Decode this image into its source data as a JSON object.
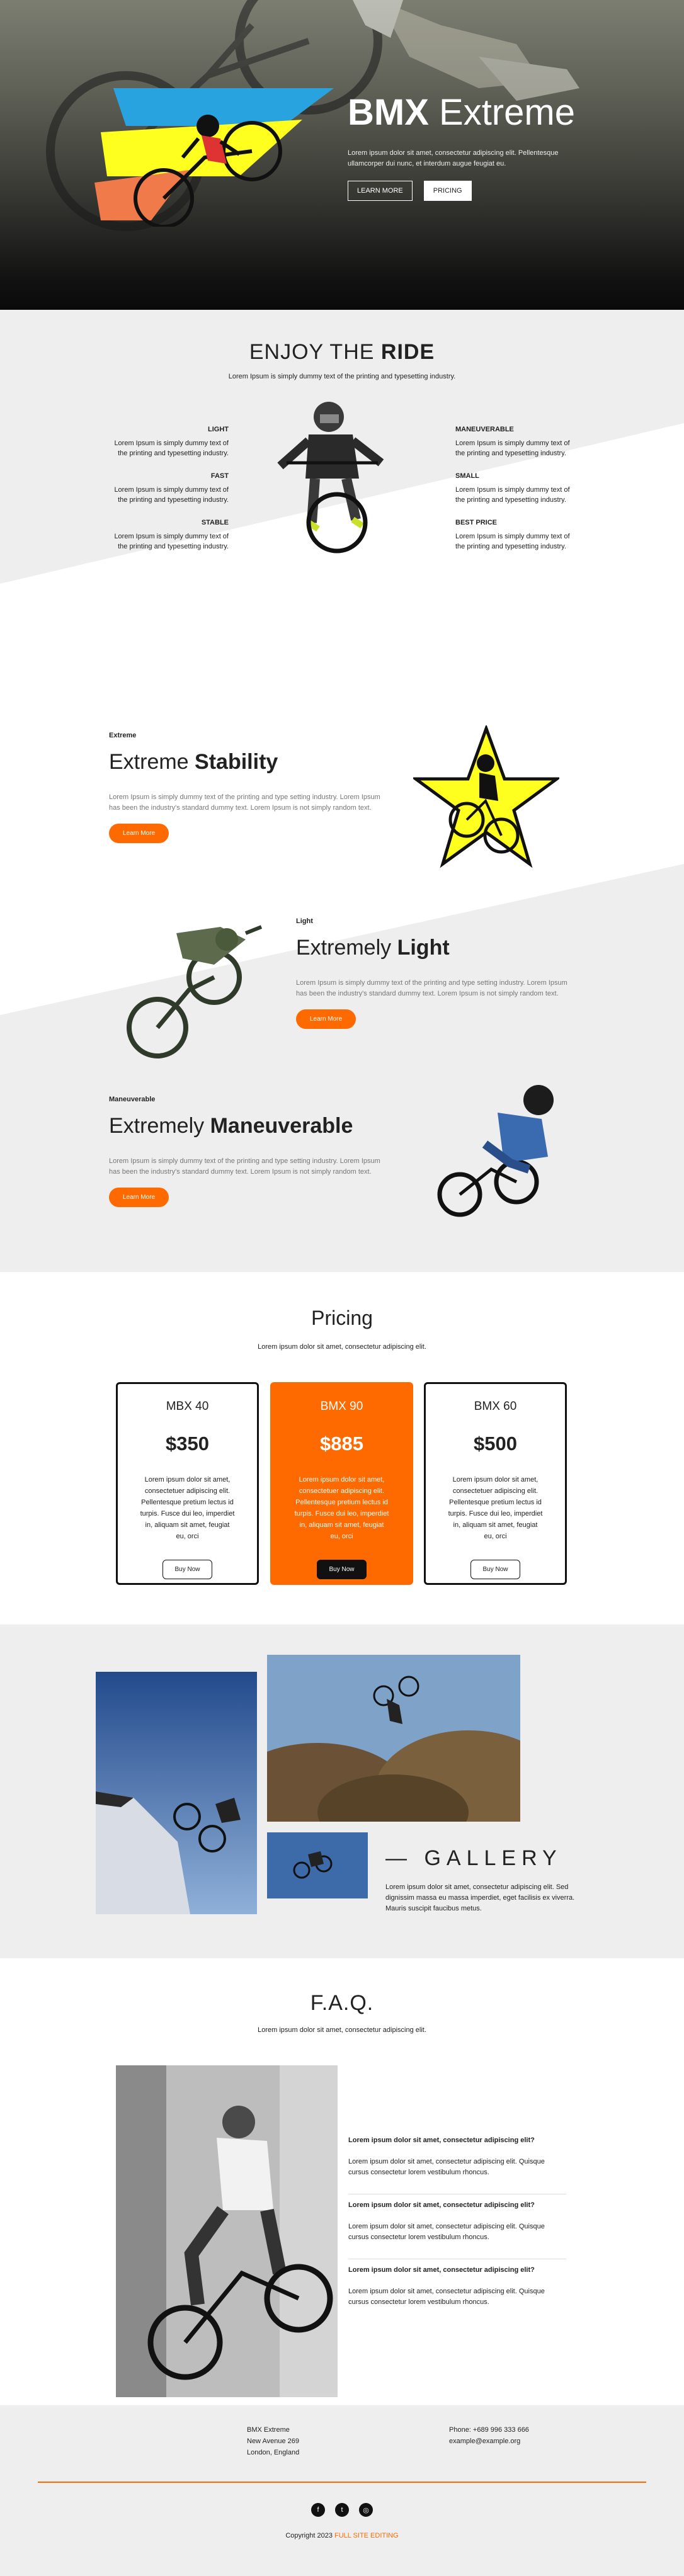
{
  "hero": {
    "title_bold": "BMX",
    "title_rest": " Extreme",
    "description": "Lorem ipsum dolor sit amet, consectetur adipiscing elit. Pellentesque ullamcorper dui nunc, et interdum augue feugiat eu.",
    "btn_learn": "LEARN MORE",
    "btn_pricing": "PRICING",
    "flag_colors": [
      "#29a3e0",
      "#ffff1f",
      "#f07a4a"
    ]
  },
  "enjoy": {
    "title_thin": "ENJOY THE ",
    "title_bold": "RIDE",
    "subtitle": "Lorem Ipsum is simply dummy text of the printing and typesetting industry.",
    "left": [
      {
        "title": "LIGHT",
        "text": "Lorem Ipsum is simply dummy text of the printing and typesetting industry."
      },
      {
        "title": "FAST",
        "text": "Lorem Ipsum is simply dummy text of the printing and typesetting industry."
      },
      {
        "title": "STABLE",
        "text": "Lorem Ipsum is simply dummy text of the printing and typesetting industry."
      }
    ],
    "right": [
      {
        "title": "MANEUVERABLE",
        "text": "Lorem Ipsum is simply dummy text of the printing and typesetting industry."
      },
      {
        "title": "SMALL",
        "text": "Lorem Ipsum is simply dummy text of the printing and typesetting industry."
      },
      {
        "title": "BEST PRICE",
        "text": "Lorem Ipsum is simply dummy text of the printing and typesetting industry."
      }
    ]
  },
  "features": [
    {
      "kicker": "Extreme",
      "title_thin": "Extreme ",
      "title_bold": "Stability",
      "text": "Lorem Ipsum is simply dummy text of the printing and type setting industry. Lorem Ipsum has been the industry's standard dummy text. Lorem Ipsum is not simply random text.",
      "button": "Learn More"
    },
    {
      "kicker": "Light",
      "title_thin": "Extremely ",
      "title_bold": "Light",
      "text": "Lorem Ipsum is simply dummy text of the printing and type setting industry. Lorem Ipsum has been the industry's standard dummy text. Lorem Ipsum is not simply random text.",
      "button": "Learn More"
    },
    {
      "kicker": "Maneuverable",
      "title_thin": "Extremely ",
      "title_bold": "Maneuverable",
      "text": "Lorem Ipsum is simply dummy text of the printing and type setting industry. Lorem Ipsum has been the industry's standard dummy text. Lorem Ipsum is not simply random text.",
      "button": "Learn More"
    }
  ],
  "pricing": {
    "title": "Pricing",
    "subtitle": "Lorem ipsum dolor sit amet, consectetur adipiscing elit.",
    "plans": [
      {
        "name": "MBX 40",
        "price": "$350",
        "text": "Lorem ipsum dolor sit amet, consectetuer adipiscing elit. Pellentesque pretium lectus id turpis. Fusce dui leo, imperdiet in, aliquam sit amet, feugiat eu, orci",
        "button": "Buy Now"
      },
      {
        "name": "BMX 90",
        "price": "$885",
        "text": "Lorem ipsum dolor sit amet, consectetuer adipiscing elit. Pellentesque pretium lectus id turpis. Fusce dui leo, imperdiet in, aliquam sit amet, feugiat eu, orci",
        "button": "Buy Now"
      },
      {
        "name": "BMX 60",
        "price": "$500",
        "text": "Lorem ipsum dolor sit amet, consectetuer adipiscing elit. Pellentesque pretium lectus id turpis. Fusce dui leo, imperdiet in, aliquam sit amet, feugiat eu, orci",
        "button": "Buy Now"
      }
    ]
  },
  "gallery": {
    "title": "— GALLERY",
    "text": "Lorem ipsum dolor sit amet, consectetur adipiscing elit. Sed dignissim massa eu massa imperdiet, eget facilisis ex viverra. Mauris suscipit faucibus metus."
  },
  "faq": {
    "title": "F.A.Q.",
    "subtitle": "Lorem ipsum dolor sit amet, consectetur adipiscing elit.",
    "items": [
      {
        "q": "Lorem ipsum dolor sit amet, consectetur adipiscing elit?",
        "a": "Lorem ipsum dolor sit amet, consectetur adipiscing elit. Quisque cursus consectetur lorem vestibulum rhoncus."
      },
      {
        "q": "Lorem ipsum dolor sit amet, consectetur adipiscing elit?",
        "a": "Lorem ipsum dolor sit amet, consectetur adipiscing elit. Quisque cursus consectetur lorem vestibulum rhoncus."
      },
      {
        "q": "Lorem ipsum dolor sit amet, consectetur adipiscing elit?",
        "a": "Lorem ipsum dolor sit amet, consectetur adipiscing elit. Quisque cursus consectetur lorem vestibulum rhoncus."
      }
    ]
  },
  "footer": {
    "address": [
      "BMX Extreme",
      "New Avenue 269",
      "London, England"
    ],
    "contact": [
      "Phone: +689 996 333 666",
      "example@example.org"
    ],
    "social_icons": [
      "facebook-icon",
      "twitter-icon",
      "instagram-icon"
    ],
    "copyright": "Copyright 2023 ",
    "credit": "FULL SITE EDITING",
    "accent": "#ff6a00"
  }
}
